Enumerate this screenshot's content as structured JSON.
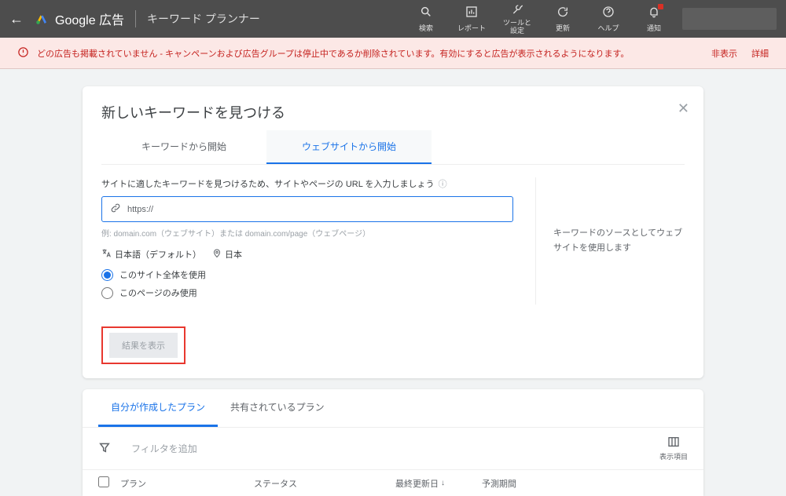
{
  "header": {
    "brand": "Google 広告",
    "page_title": "キーワード プランナー",
    "nav": {
      "search": "検索",
      "report": "レポート",
      "tools": "ツールと\n設定",
      "refresh": "更新",
      "help": "ヘルプ",
      "notify": "通知"
    }
  },
  "alert": {
    "message": "どの広告も掲載されていません - キャンペーンおよび広告グループは停止中であるか削除されています。有効にすると広告が表示されるようになります。",
    "hide": "非表示",
    "detail": "詳細"
  },
  "card": {
    "title": "新しいキーワードを見つける",
    "tab_keywords": "キーワードから開始",
    "tab_website": "ウェブサイトから開始",
    "instruct": "サイトに適したキーワードを見つけるため、サイトやページの URL を入力しましょう",
    "input_value": "https://",
    "hint": "例: domain.com（ウェブサイト）または domain.com/page（ウェブページ）",
    "lang": "日本語（デフォルト）",
    "loc": "日本",
    "radio_whole": "このサイト全体を使用",
    "radio_page": "このページのみ使用",
    "side_note": "キーワードのソースとしてウェブサイトを使用します",
    "submit": "結果を表示"
  },
  "plans": {
    "tab_mine": "自分が作成したプラン",
    "tab_shared": "共有されているプラン",
    "filter_add": "フィルタを追加",
    "cols_label": "表示項目",
    "thead": {
      "plan": "プラン",
      "status": "ステータス",
      "updated": "最終更新日",
      "period": "予測期間"
    }
  }
}
